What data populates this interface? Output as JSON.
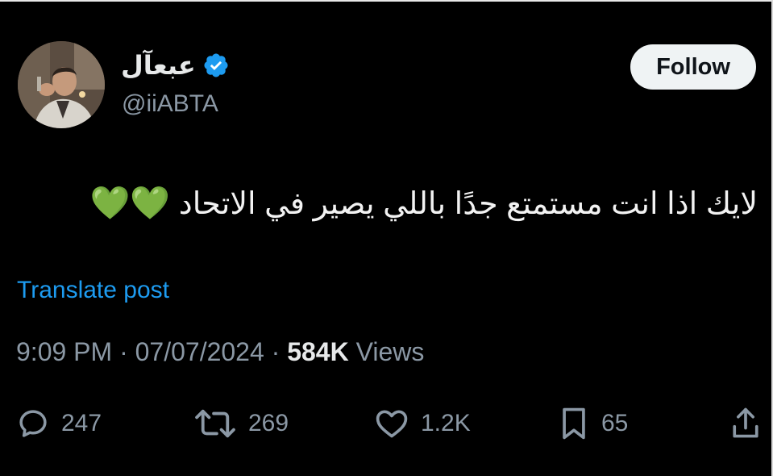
{
  "author": {
    "display_name": "عبعآل",
    "handle": "@iiABTA",
    "verified": true
  },
  "follow_button": {
    "label": "Follow"
  },
  "tweet": {
    "text": "لايك اذا انت مستمتع جدًا باللي يصير في الاتحاد",
    "emoji": "💚💚"
  },
  "translate": {
    "label": "Translate post"
  },
  "meta": {
    "time": "9:09 PM",
    "separator": "·",
    "date": "07/07/2024",
    "views_count": "584K",
    "views_label": "Views"
  },
  "actions": {
    "replies": "247",
    "reposts": "269",
    "likes": "1.2K",
    "bookmarks": "65"
  },
  "colors": {
    "background": "#000000",
    "text_primary": "#e7e9ea",
    "text_secondary": "#8b98a5",
    "link": "#1d9bf0",
    "verified": "#1d9bf0",
    "follow_bg": "#eff3f4",
    "heart_emoji": "#4cc83c"
  },
  "icons": {
    "reply": "reply-icon",
    "repost": "repost-icon",
    "like": "heart-icon",
    "bookmark": "bookmark-icon",
    "share": "share-icon",
    "verified": "verified-badge-icon"
  }
}
